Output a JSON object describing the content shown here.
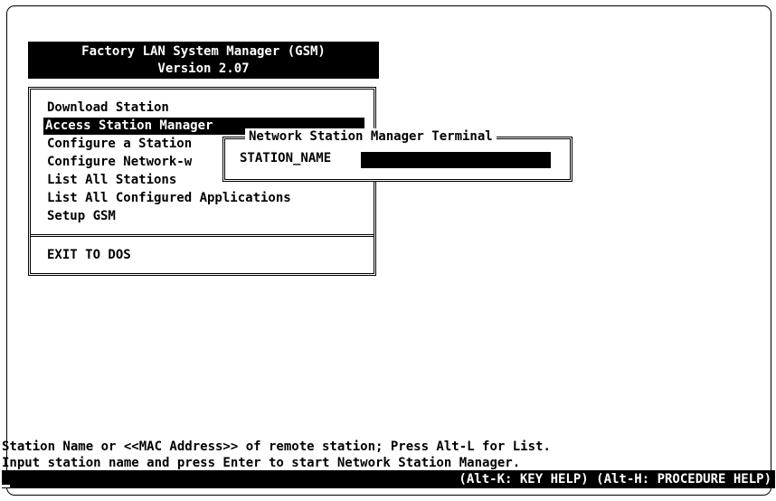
{
  "app": {
    "title_line1": "Factory LAN System Manager (GSM)",
    "title_line2": "Version 2.07"
  },
  "menu": {
    "items": [
      {
        "label": "Download Station",
        "selected": false
      },
      {
        "label": "Access Station Manager",
        "selected": true
      },
      {
        "label": "Configure a Station",
        "selected": false
      },
      {
        "label": "Configure Network-w",
        "selected": false
      },
      {
        "label": "List All Stations",
        "selected": false
      },
      {
        "label": "List All Configured Applications",
        "selected": false
      },
      {
        "label": "Setup GSM",
        "selected": false
      }
    ],
    "exit_label": "EXIT TO DOS"
  },
  "popup": {
    "title": "Network Station Manager Terminal",
    "field_label": "STATION_NAME",
    "field_value": ""
  },
  "status": {
    "line1": "Station Name or <<MAC Address>> of remote station; Press Alt-L for List.",
    "line2": "Input station name and press Enter to start Network Station Manager.",
    "help": "(Alt-K: KEY HELP) (Alt-H: PROCEDURE HELP)"
  }
}
